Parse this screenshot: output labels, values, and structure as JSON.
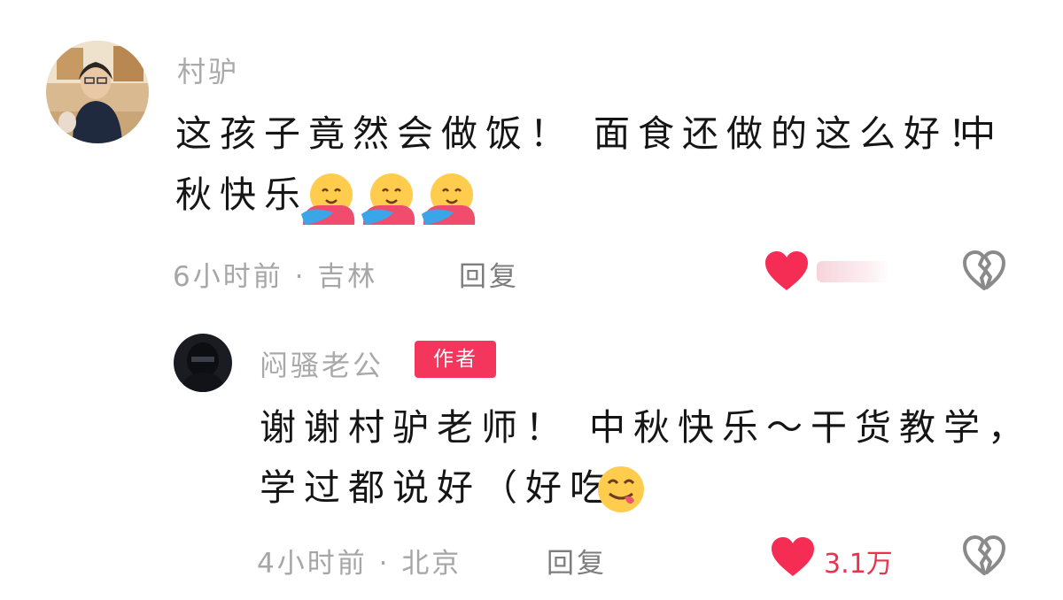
{
  "comment": {
    "username": "村驴",
    "text_line1": "这孩子竟然会做饭！ 面食还做的这么好！",
    "text_line1_tail": "中",
    "text_line2": "秋快乐",
    "emoji": "hugging-face-emoji",
    "time": "6小时前",
    "location": "吉林",
    "reply_label": "回复"
  },
  "reply": {
    "username": "闷骚老公",
    "badge": "作者",
    "text_line1": "谢谢村驴老师！ 中秋快乐～干货教学，",
    "text_line2": "学过都说好（好吃",
    "emoji": "face-savoring-food-emoji",
    "time": "4小时前",
    "location": "北京",
    "reply_label": "回复",
    "like_count": "3.1万"
  },
  "colors": {
    "like": "#f52c54",
    "badge": "#f5365c",
    "count": "#e8344f"
  },
  "icons": {
    "like": "heart-icon",
    "dislike": "broken-heart-icon"
  }
}
